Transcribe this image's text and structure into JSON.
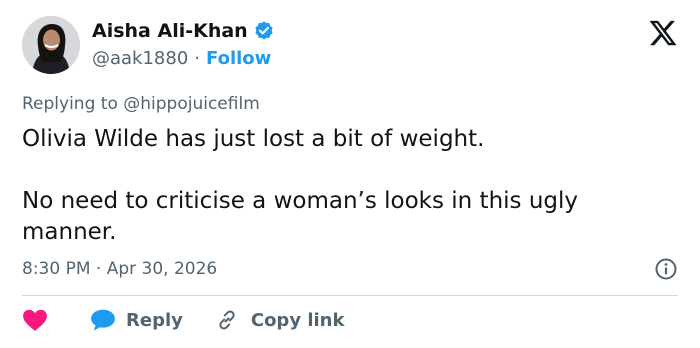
{
  "author": {
    "name": "Aisha Ali-Khan",
    "handle": "@aak1880",
    "separator": "·",
    "follow_label": "Follow"
  },
  "reply_context": {
    "prefix": "Replying to",
    "mention": "@hippojuicefilm"
  },
  "tweet": {
    "line1": "Olivia Wilde has just lost a bit of weight.",
    "line2": "No need to criticise a woman’s looks in this ugly manner."
  },
  "timestamp": "8:30 PM · Apr 30, 2026",
  "actions": {
    "reply_label": "Reply",
    "copy_link_label": "Copy link"
  },
  "icons": {
    "verified": "verified-badge-icon",
    "logo": "x-logo-icon",
    "info": "info-icon",
    "like": "heart-icon",
    "reply": "speech-bubble-icon",
    "copy": "link-icon"
  },
  "colors": {
    "accent": "#1d9bf0",
    "heart": "#f91880",
    "text": "#0f1419",
    "muted": "#536471"
  }
}
